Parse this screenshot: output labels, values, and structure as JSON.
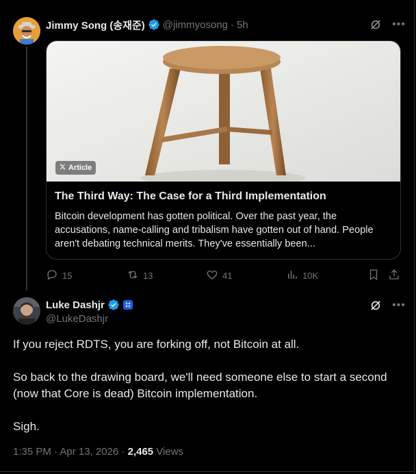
{
  "parent_tweet": {
    "author_name": "Jimmy Song (송재준)",
    "handle": "@jimmyosong",
    "time_sep": "·",
    "time": "5h",
    "verified_icon": "verified-badge-icon",
    "card": {
      "badge_label": "Article",
      "badge_icon": "x-logo-icon",
      "title": "The Third Way: The Case for a Third Implementation",
      "description": "Bitcoin development has gotten political. Over the past year, the accusations, name-calling and tribalism have gotten out of hand. People aren't debating technical merits. They've essentially been..."
    },
    "actions": {
      "replies": "15",
      "reposts": "13",
      "likes": "41",
      "views": "10K"
    }
  },
  "main_tweet": {
    "author_name": "Luke Dashjr",
    "handle": "@LukeDashjr",
    "verified_icon": "verified-badge-icon",
    "affiliate_icon": "affiliate-badge-icon",
    "paragraphs": [
      "If you reject RDTS, you are forking off, not Bitcoin at all.",
      "So back to the drawing board, we'll need someone else to start a second (now that Core is dead) Bitcoin implementation.",
      "Sigh."
    ],
    "timestamp": "1:35 PM · Apr 13, 2026 ·",
    "views_count": "2,465",
    "views_label": "Views"
  },
  "colors": {
    "background": "#000000",
    "text": "#e7e9ea",
    "muted": "#71767b",
    "verified_blue": "#1d9bf0",
    "border": "#2f3336"
  }
}
